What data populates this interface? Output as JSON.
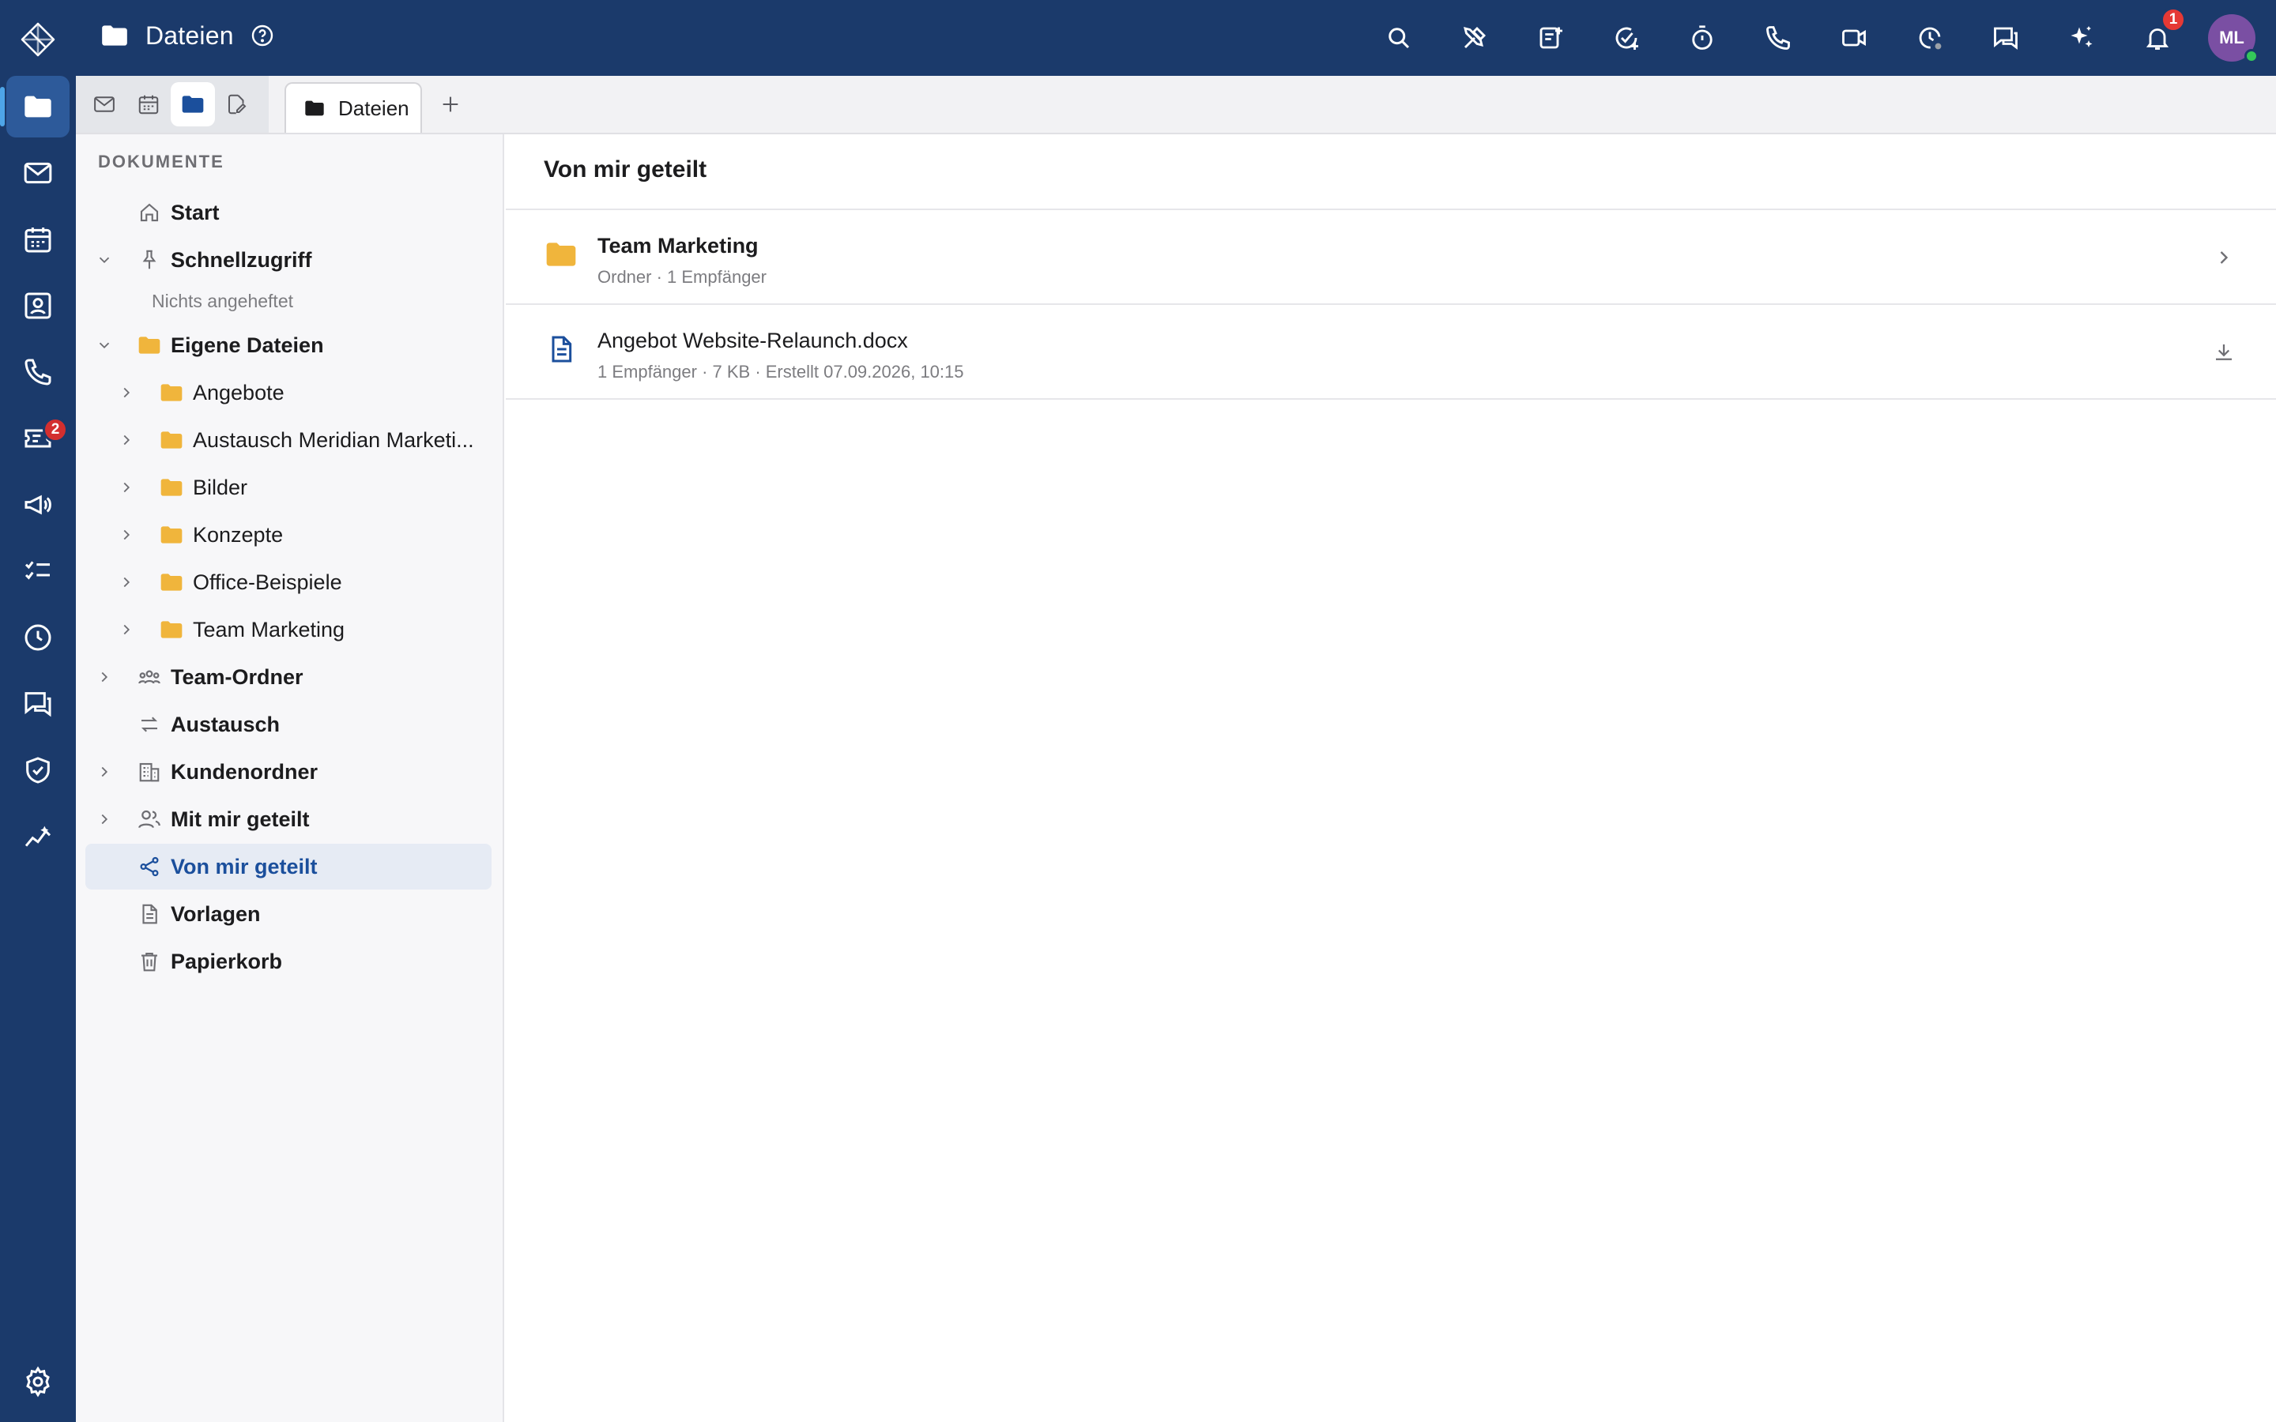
{
  "header": {
    "app_title": "Dateien",
    "notification_count": "1",
    "avatar_initials": "ML",
    "icons": [
      "search-icon",
      "tools-icon",
      "note-add-icon",
      "task-add-icon",
      "timer-icon",
      "phone-icon",
      "video-icon",
      "clock-status-icon",
      "chat-icon",
      "sparkles-icon",
      "bell-icon"
    ]
  },
  "rail": {
    "items": [
      "folder-icon",
      "mail-icon",
      "calendar-icon",
      "contacts-icon",
      "phone-icon",
      "ticket-icon",
      "megaphone-icon",
      "checklist-icon",
      "clock-icon",
      "chat-icon",
      "shield-icon",
      "analytics-icon"
    ],
    "ticket_badge": "2"
  },
  "tabs": {
    "modes": [
      "mail-icon",
      "calendar-icon",
      "folder-icon",
      "document-edit-icon"
    ],
    "open_tab": "Dateien"
  },
  "sidebar": {
    "section_label": "DOKUMENTE",
    "start": "Start",
    "quick_access": "Schnellzugriff",
    "quick_access_empty": "Nichts angeheftet",
    "own_files": "Eigene Dateien",
    "own_children": [
      "Angebote",
      "Austausch Meridian Marketi...",
      "Bilder",
      "Konzepte",
      "Office-Beispiele",
      "Team Marketing"
    ],
    "team_folders": "Team-Ordner",
    "exchange": "Austausch",
    "customer_folders": "Kundenordner",
    "shared_with_me": "Mit mir geteilt",
    "shared_by_me": "Von mir geteilt",
    "templates": "Vorlagen",
    "trash": "Papierkorb"
  },
  "main": {
    "title": "Von mir geteilt",
    "items": [
      {
        "name": "Team Marketing",
        "meta": "Ordner · 1 Empfänger",
        "type": "folder"
      },
      {
        "name": "Angebot Website-Relaunch.docx",
        "meta": "1 Empfänger · 7 KB · Erstellt 07.09.2026, 10:15",
        "type": "document"
      }
    ]
  },
  "colors": {
    "brand": "#1b3a6b",
    "accent": "#1b4f9c",
    "folder": "#f0b53c",
    "badge": "#e53935"
  }
}
